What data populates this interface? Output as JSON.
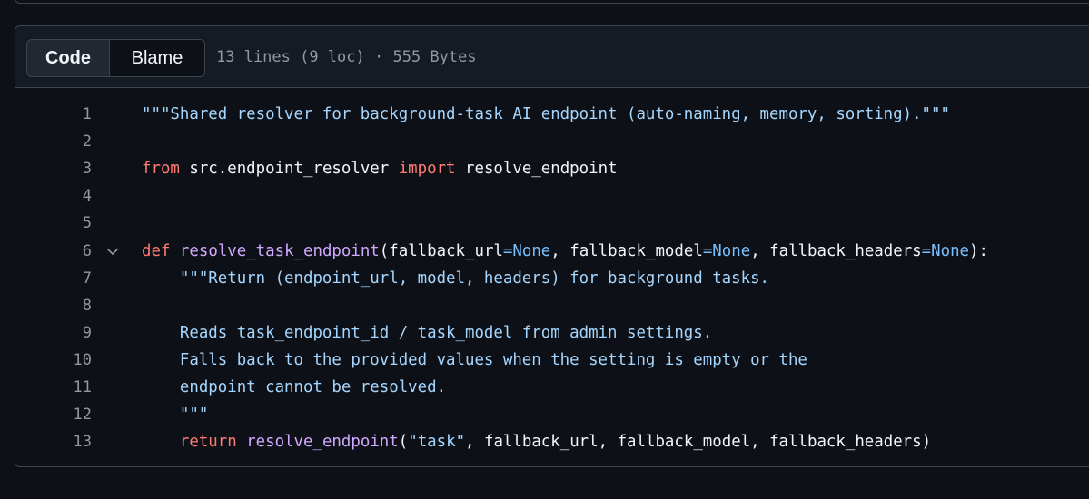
{
  "toolbar": {
    "code_label": "Code",
    "blame_label": "Blame",
    "file_info": "13 lines (9 loc) · 555 Bytes"
  },
  "lines": [
    {
      "num": "1",
      "tokens": [
        {
          "t": "str",
          "v": "\"\"\"Shared resolver for background-task AI endpoint (auto-naming, memory, sorting).\"\"\""
        }
      ]
    },
    {
      "num": "2",
      "tokens": []
    },
    {
      "num": "3",
      "tokens": [
        {
          "t": "kw",
          "v": "from"
        },
        {
          "t": "plain",
          "v": " src.endpoint_resolver "
        },
        {
          "t": "kw",
          "v": "import"
        },
        {
          "t": "plain",
          "v": " resolve_endpoint"
        }
      ]
    },
    {
      "num": "4",
      "tokens": []
    },
    {
      "num": "5",
      "tokens": []
    },
    {
      "num": "6",
      "fold": true,
      "tokens": [
        {
          "t": "kw",
          "v": "def"
        },
        {
          "t": "plain",
          "v": " "
        },
        {
          "t": "fn",
          "v": "resolve_task_endpoint"
        },
        {
          "t": "plain",
          "v": "(fallback_url"
        },
        {
          "t": "op",
          "v": "="
        },
        {
          "t": "const",
          "v": "None"
        },
        {
          "t": "plain",
          "v": ", fallback_model"
        },
        {
          "t": "op",
          "v": "="
        },
        {
          "t": "const",
          "v": "None"
        },
        {
          "t": "plain",
          "v": ", fallback_headers"
        },
        {
          "t": "op",
          "v": "="
        },
        {
          "t": "const",
          "v": "None"
        },
        {
          "t": "plain",
          "v": "):"
        }
      ]
    },
    {
      "num": "7",
      "tokens": [
        {
          "t": "str",
          "v": "    \"\"\"Return (endpoint_url, model, headers) for background tasks."
        }
      ]
    },
    {
      "num": "8",
      "tokens": []
    },
    {
      "num": "9",
      "tokens": [
        {
          "t": "str",
          "v": "    Reads task_endpoint_id / task_model from admin settings."
        }
      ]
    },
    {
      "num": "10",
      "tokens": [
        {
          "t": "str",
          "v": "    Falls back to the provided values when the setting is empty or the"
        }
      ]
    },
    {
      "num": "11",
      "tokens": [
        {
          "t": "str",
          "v": "    endpoint cannot be resolved."
        }
      ]
    },
    {
      "num": "12",
      "tokens": [
        {
          "t": "str",
          "v": "    \"\"\""
        }
      ]
    },
    {
      "num": "13",
      "tokens": [
        {
          "t": "plain",
          "v": "    "
        },
        {
          "t": "kw",
          "v": "return"
        },
        {
          "t": "plain",
          "v": " "
        },
        {
          "t": "fn",
          "v": "resolve_endpoint"
        },
        {
          "t": "plain",
          "v": "("
        },
        {
          "t": "str",
          "v": "\"task\""
        },
        {
          "t": "plain",
          "v": ", fallback_url, fallback_model, fallback_headers)"
        }
      ]
    }
  ],
  "icons": {
    "fold": "chevron-down-icon"
  },
  "colors": {
    "background": "#0d1117",
    "header": "#151b23",
    "border": "#3d444d",
    "string": "#a5d6ff",
    "keyword": "#ff7b72",
    "function": "#d2a8ff",
    "constant": "#79c0ff"
  }
}
